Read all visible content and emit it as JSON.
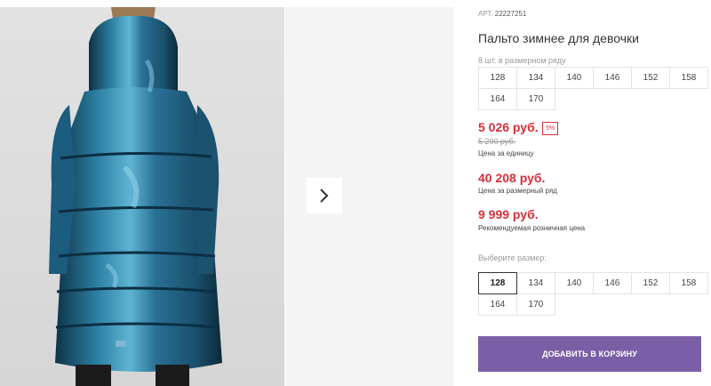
{
  "article": {
    "label": "АРТ.",
    "number": "22227251"
  },
  "product": {
    "title": "Пальто зимнее для девочки"
  },
  "size_range": {
    "label": "8 шт. в размерном ряду",
    "sizes": [
      "128",
      "134",
      "140",
      "146",
      "152",
      "158",
      "164",
      "170"
    ]
  },
  "pricing": {
    "unit_price": "5 026 руб.",
    "discount": "5%",
    "old_price": "5 290 руб.",
    "unit_caption": "Цена за единицу",
    "range_price": "40 208 руб.",
    "range_caption": "Цена за размерный ряд",
    "retail_price": "9 999 руб.",
    "retail_caption": "Рекомендуемая розничная цена"
  },
  "size_select": {
    "label": "Выберите размер:",
    "selected": "128",
    "sizes": [
      "128",
      "134",
      "140",
      "146",
      "152",
      "158",
      "164",
      "170"
    ]
  },
  "cart": {
    "button_label": "ДОБАВИТЬ В КОРЗИНУ"
  },
  "colors": {
    "price": "#d72e3a",
    "cart_button": "#7a5ea6",
    "coat": "#1d5a78"
  },
  "icons": {
    "next": "chevron-right-icon"
  }
}
